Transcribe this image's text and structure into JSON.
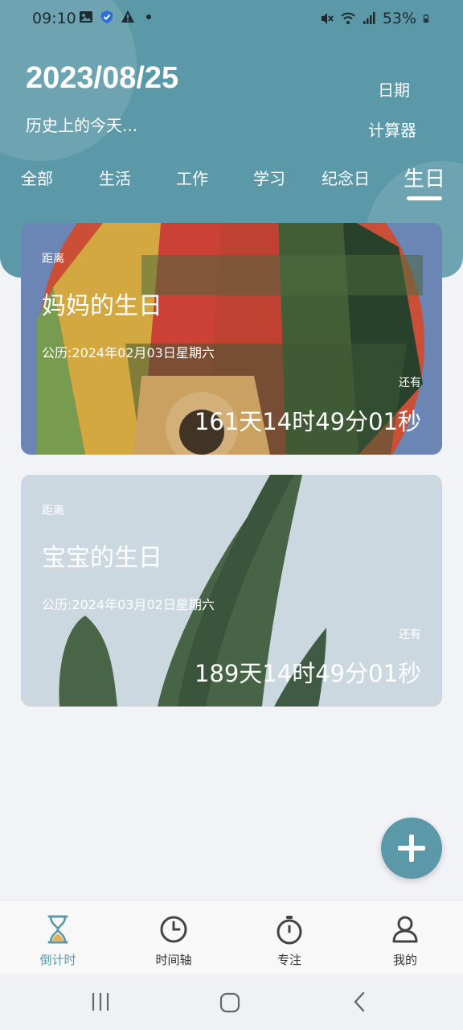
{
  "status_bar": {
    "time": "09:10",
    "battery": "53%",
    "icons_left": [
      "gallery-icon",
      "shield-icon",
      "warning-icon",
      "dot-icon"
    ],
    "icons_right": [
      "mute-icon",
      "wifi-icon",
      "signal-icon",
      "battery-icon"
    ]
  },
  "header": {
    "date": "2023/08/25",
    "history_link": "历史上的今天...",
    "calculator_line1": "日期",
    "calculator_line2": "计算器",
    "accent_color": "#5b98a8"
  },
  "tabs": [
    {
      "label": "全部"
    },
    {
      "label": "生活"
    },
    {
      "label": "工作"
    },
    {
      "label": "学习"
    },
    {
      "label": "纪念日"
    },
    {
      "label": "生日"
    }
  ],
  "active_tab": "生日",
  "cards": [
    {
      "distance_label": "距离",
      "title": "妈妈的生日",
      "solar_date": "公历:2024年02月03日星期六",
      "remaining_label": "还有",
      "countdown": "161天14时49分01秒",
      "background": "hot-air-balloon"
    },
    {
      "distance_label": "距离",
      "title": "宝宝的生日",
      "solar_date": "公历:2024年03月02日星期六",
      "remaining_label": "还有",
      "countdown": "189天14时49分01秒",
      "background": "green-leaves"
    }
  ],
  "fab": {
    "icon": "plus-icon"
  },
  "bottom_nav": [
    {
      "label": "倒计时",
      "icon": "hourglass-icon",
      "active": true
    },
    {
      "label": "时间轴",
      "icon": "clock-icon",
      "active": false
    },
    {
      "label": "专注",
      "icon": "stopwatch-icon",
      "active": false
    },
    {
      "label": "我的",
      "icon": "profile-icon",
      "active": false
    }
  ],
  "system_nav": [
    "recents-icon",
    "home-icon",
    "back-icon"
  ]
}
